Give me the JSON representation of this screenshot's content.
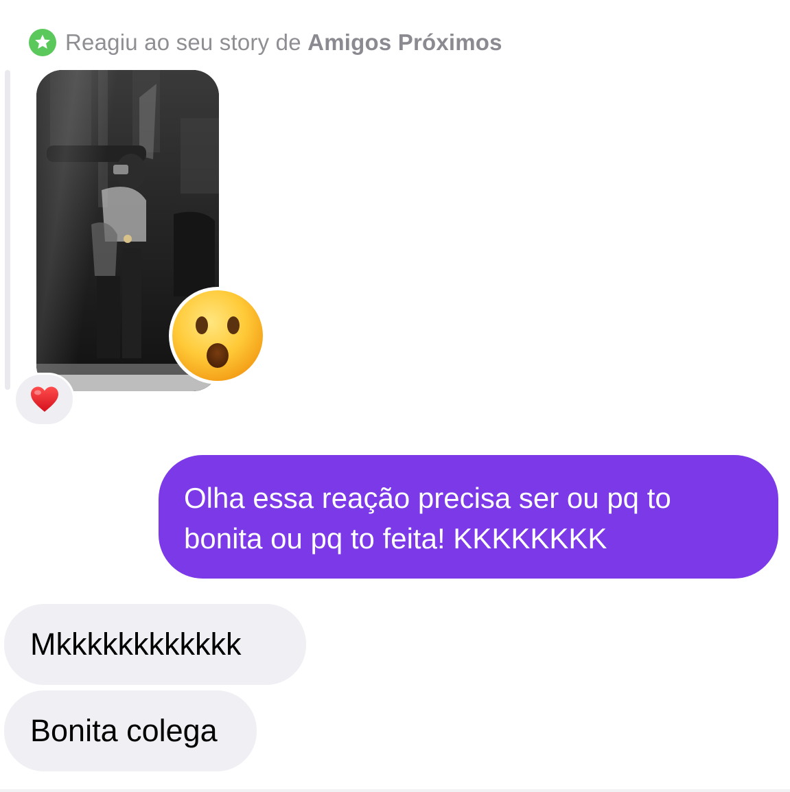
{
  "story_reply": {
    "prefix": "Reagiu ao seu story de ",
    "audience": "Amigos Próximos",
    "badge_icon": "star-icon",
    "badge_color": "#5ac85a"
  },
  "story": {
    "thumbnail_icon": "story-photo",
    "reaction_emoji": "😮",
    "heart_reaction": "❤️"
  },
  "messages": [
    {
      "direction": "sent",
      "text": "Olha essa reação precisa ser ou pq to bonita ou pq to feita! KKKKKKKK",
      "bubble_color": "#7b39e8"
    },
    {
      "direction": "received",
      "text": "Mkkkkkkkkkkkk",
      "bubble_color": "#efeff4"
    },
    {
      "direction": "received",
      "text": "Bonita colega",
      "bubble_color": "#efeff4"
    }
  ]
}
